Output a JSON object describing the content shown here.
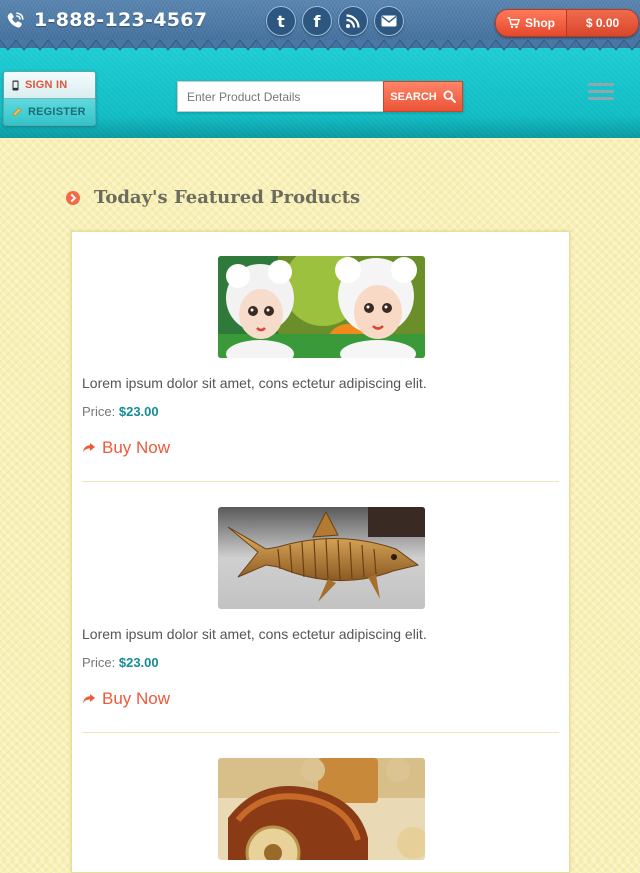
{
  "header": {
    "phone": "1-888-123-4567",
    "social_icons": [
      "twitter-icon",
      "facebook-icon",
      "rss-icon",
      "email-icon"
    ],
    "cart": {
      "label": "Shop",
      "total": "$ 0.00"
    }
  },
  "nav": {
    "sign_in": "SIGN IN",
    "register": "REGISTER",
    "search": {
      "placeholder": "Enter Product Details",
      "button": "SEARCH"
    },
    "menu_icon": "hamburger-menu-icon"
  },
  "colors": {
    "accent": "#f26a46",
    "teal": "#12bfc6",
    "denim": "#4a78a6",
    "price": "#168c96"
  },
  "main": {
    "section_title": "Today's Featured Products",
    "products": [
      {
        "image": "toy-sheep-figurines",
        "description": "Lorem ipsum dolor sit amet, cons ectetur adipiscing elit.",
        "price_label": "Price:",
        "price": "$23.00",
        "cta": "Buy Now"
      },
      {
        "image": "wooden-shark-toy",
        "description": "Lorem ipsum dolor sit amet, cons ectetur adipiscing elit.",
        "price_label": "Price:",
        "price": "$23.00",
        "cta": "Buy Now"
      },
      {
        "image": "wooden-toy-car",
        "description": "",
        "price_label": "",
        "price": "",
        "cta": ""
      }
    ]
  }
}
